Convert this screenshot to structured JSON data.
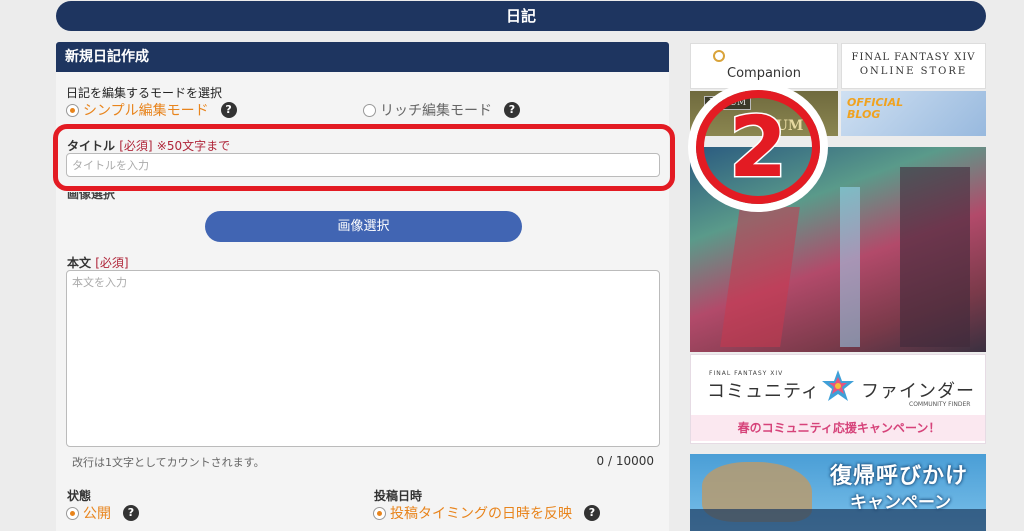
{
  "header": {
    "title": "日記"
  },
  "panel": {
    "title": "新規日記作成"
  },
  "mode": {
    "label": "日記を編集するモードを選択",
    "simple_label": "シンプル編集モード",
    "rich_label": "リッチ編集モード",
    "selected": "simple"
  },
  "title_field": {
    "label": "タイトル",
    "required": "[必須]",
    "limit_note": "※50文字まで",
    "placeholder": "タイトルを入力",
    "value": ""
  },
  "image": {
    "label": "画像選択",
    "button_label": "画像選択"
  },
  "body": {
    "label": "本文",
    "required": "[必須]",
    "placeholder": "本文を入力",
    "hint": "改行は1文字としてカウントされます。",
    "counter": "0 / 10000"
  },
  "status": {
    "label": "状態",
    "option_label": "公開"
  },
  "post_date": {
    "label": "投稿日時",
    "option_label": "投稿タイミングの日時を反映"
  },
  "help_glyph": "?",
  "annotation": {
    "number": "2",
    "color": "#e31b23"
  },
  "banners": {
    "companion": "Companion",
    "store_line1": "FINAL FANTASY XIV",
    "store_line2": "ONLINE STORE",
    "forum_tag": "FORUM",
    "forum_text": "RUM",
    "blog_line1": "OFFICIAL",
    "blog_line2": "BLOG",
    "finder_ff": "FINAL FANTASY XIV",
    "finder_title_left": "コミュニティ",
    "finder_title_right": "ファインダー",
    "finder_sub": "COMMUNITY FINDER",
    "finder_ribbon": "春のコミュニティ応援キャンペーン！",
    "return_line1": "復帰呼びかけ",
    "return_line2": "キャンペーン"
  },
  "colors": {
    "navy": "#1e3560",
    "accent_orange": "#e8841c",
    "required_red": "#b0263a",
    "button_blue": "#4165b3",
    "highlight_red": "#e31b23"
  }
}
